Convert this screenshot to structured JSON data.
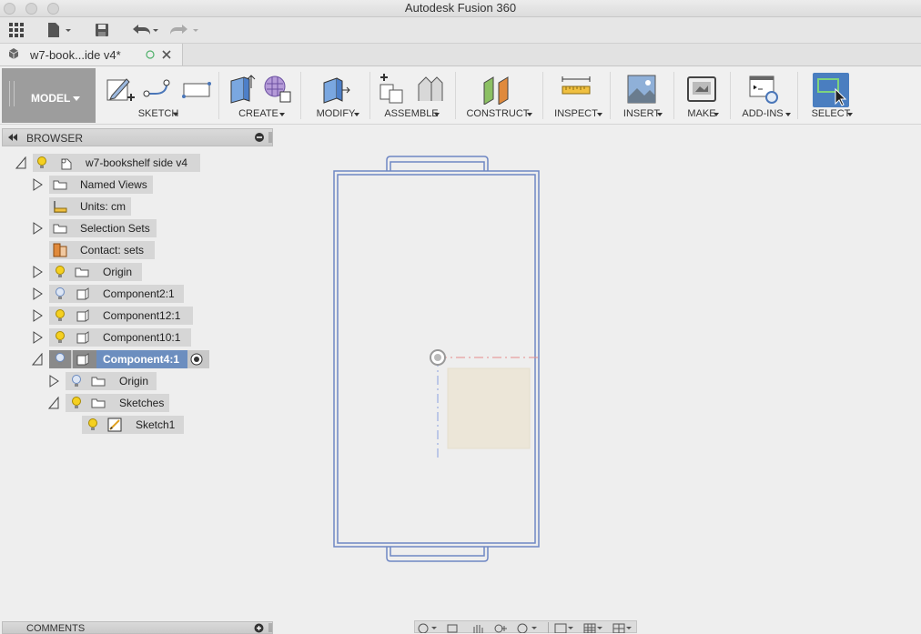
{
  "window": {
    "title": "Autodesk Fusion 360"
  },
  "document_tab": {
    "name": "w7-book...ide v4*"
  },
  "ribbon": {
    "workspace": "MODEL",
    "groups": [
      {
        "label": "SKETCH"
      },
      {
        "label": "CREATE"
      },
      {
        "label": "MODIFY"
      },
      {
        "label": "ASSEMBLE"
      },
      {
        "label": "CONSTRUCT"
      },
      {
        "label": "INSPECT"
      },
      {
        "label": "INSERT"
      },
      {
        "label": "MAKE"
      },
      {
        "label": "ADD-INS"
      },
      {
        "label": "SELECT"
      }
    ]
  },
  "browser": {
    "title": "BROWSER",
    "root": "w7-bookshelf side v4",
    "items": [
      {
        "label": "Named Views"
      },
      {
        "label": "Units: cm"
      },
      {
        "label": "Selection Sets"
      },
      {
        "label": "Contact: sets"
      },
      {
        "label": "Origin"
      },
      {
        "label": "Component2:1"
      },
      {
        "label": "Component12:1"
      },
      {
        "label": "Component10:1"
      },
      {
        "label": "Component4:1"
      },
      {
        "label": "Origin"
      },
      {
        "label": "Sketches"
      },
      {
        "label": "Sketch1"
      }
    ]
  },
  "comments": {
    "title": "COMMENTS"
  },
  "colors": {
    "selection": "#6c8ebf",
    "outline": "#6f87c4",
    "select_tool": "#4a7ec0"
  }
}
